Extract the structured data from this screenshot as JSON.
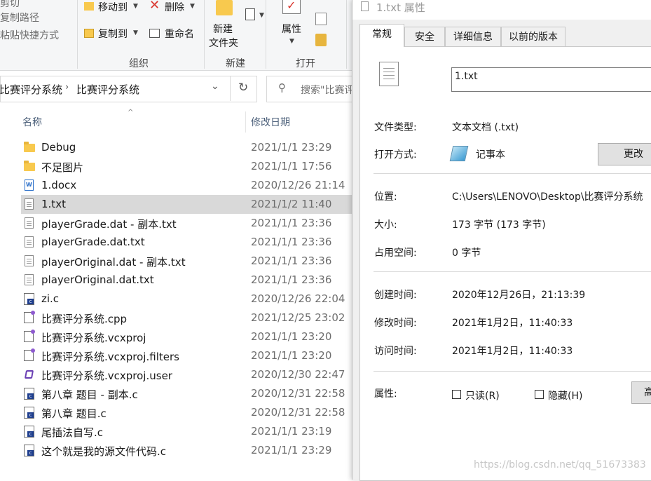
{
  "ribbon": {
    "top_left_1": "复制路径",
    "top_left_2": "粘贴快捷方式",
    "move_to": "移动到",
    "copy_to": "复制到",
    "delete": "删除",
    "rename": "重命名",
    "new_folder_1": "新建",
    "new_folder_2": "文件夹",
    "properties": "属性",
    "group_organize": "组织",
    "group_new": "新建",
    "group_open": "打开"
  },
  "address": {
    "crumb_1": "比赛评分系统",
    "crumb_2": "比赛评分系统",
    "search_placeholder": "搜索\"比赛评"
  },
  "columns": {
    "name": "名称",
    "modified": "修改日期"
  },
  "files": [
    {
      "name": "Debug",
      "date": "2021/1/1 23:29",
      "icon": "folder-icon"
    },
    {
      "name": "不足图片",
      "date": "2021/1/1 17:56",
      "icon": "folder-icon"
    },
    {
      "name": "1.docx",
      "date": "2020/12/26 21:14",
      "icon": "word-doc-icon"
    },
    {
      "name": "1.txt",
      "date": "2021/1/2 11:40",
      "icon": "text-file-icon",
      "selected": true
    },
    {
      "name": "playerGrade.dat - 副本.txt",
      "date": "2021/1/1 23:36",
      "icon": "text-file-icon"
    },
    {
      "name": "playerGrade.dat.txt",
      "date": "2021/1/1 23:36",
      "icon": "text-file-icon"
    },
    {
      "name": "playerOriginal.dat - 副本.txt",
      "date": "2021/1/1 23:36",
      "icon": "text-file-icon"
    },
    {
      "name": "playerOriginal.dat.txt",
      "date": "2021/1/1 23:36",
      "icon": "text-file-icon"
    },
    {
      "name": "zi.c",
      "date": "2020/12/26 22:04",
      "icon": "c-source-icon"
    },
    {
      "name": "比赛评分系统.cpp",
      "date": "2021/12/25 23:02",
      "icon": "cpp-source-icon"
    },
    {
      "name": "比赛评分系统.vcxproj",
      "date": "2021/1/1 23:20",
      "icon": "vcxproj-icon"
    },
    {
      "name": "比赛评分系统.vcxproj.filters",
      "date": "2021/1/1 23:20",
      "icon": "filters-icon"
    },
    {
      "name": "比赛评分系统.vcxproj.user",
      "date": "2020/12/30 22:47",
      "icon": "vs-user-icon"
    },
    {
      "name": "第八章 题目 - 副本.c",
      "date": "2020/12/31 22:58",
      "icon": "c-source-icon"
    },
    {
      "name": "第八章 题目.c",
      "date": "2020/12/31 22:58",
      "icon": "c-source-icon"
    },
    {
      "name": "尾插法自写.c",
      "date": "2021/1/1 23:19",
      "icon": "c-source-icon"
    },
    {
      "name": "这个就是我的源文件代码.c",
      "date": "2021/1/1 23:29",
      "icon": "c-source-icon"
    }
  ],
  "dialog": {
    "title": "1.txt 属性",
    "tabs": [
      "常规",
      "安全",
      "详细信息",
      "以前的版本"
    ],
    "filename": "1.txt",
    "file_type_label": "文件类型:",
    "file_type_value": "文本文档 (.txt)",
    "open_with_label": "打开方式:",
    "open_with_value": "记事本",
    "change_button": "更改",
    "location_label": "位置:",
    "location_value": "C:\\Users\\LENOVO\\Desktop\\比赛评分系统",
    "size_label": "大小:",
    "size_value": "173 字节 (173 字节)",
    "disk_label": "占用空间:",
    "disk_value": "0 字节",
    "created_label": "创建时间:",
    "created_value": "2020年12月26日，21:13:39",
    "modified_label": "修改时间:",
    "modified_value": "2021年1月2日，11:40:33",
    "accessed_label": "访问时间:",
    "accessed_value": "2021年1月2日，11:40:33",
    "attributes_label": "属性:",
    "readonly_label": "只读(R)",
    "hidden_label": "隐藏(H)",
    "advanced_button": "高"
  },
  "watermark": "https://blog.csdn.net/qq_51673383"
}
